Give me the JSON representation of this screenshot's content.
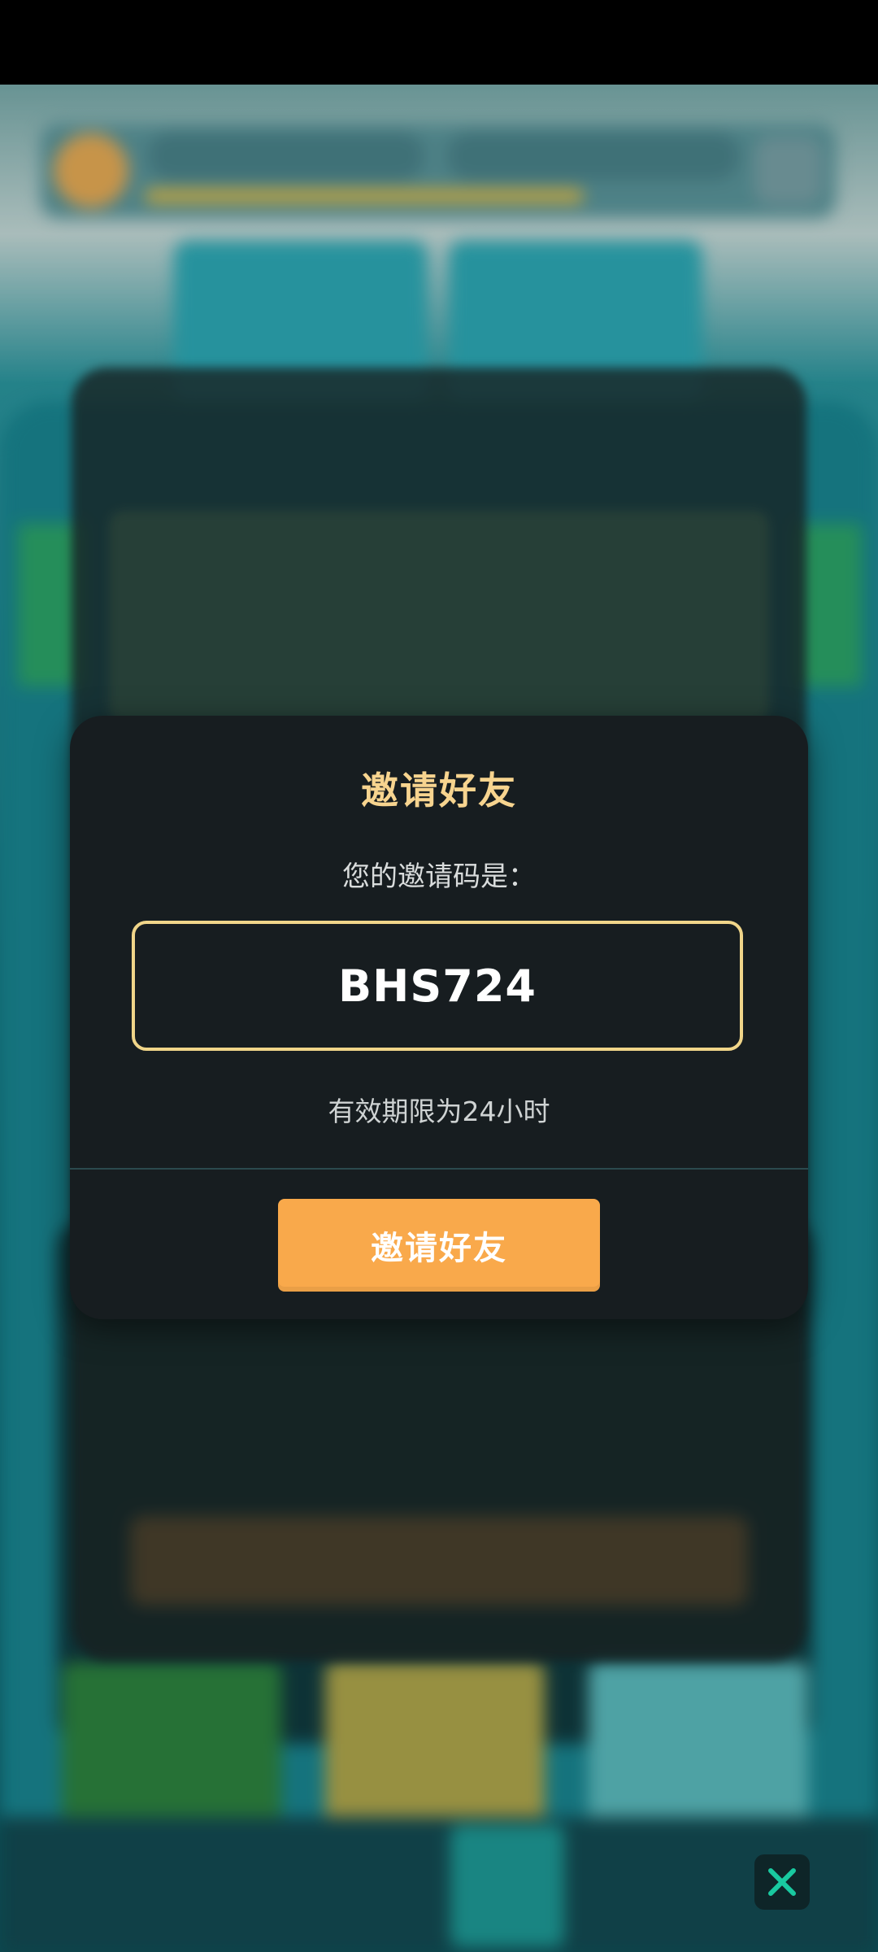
{
  "modal": {
    "title": "邀请好友",
    "subtitle": "您的邀请码是：",
    "invite_code": "BHS724",
    "expiry_text": "有效期限为24小时",
    "invite_button_label": "邀请好友"
  },
  "icons": {
    "close": "close-icon"
  },
  "colors": {
    "modal_background": "#171d20",
    "title": "#f7d48f",
    "code_border": "#f0d589",
    "button": "#f9a94b",
    "close_icon": "#19c9a0"
  }
}
